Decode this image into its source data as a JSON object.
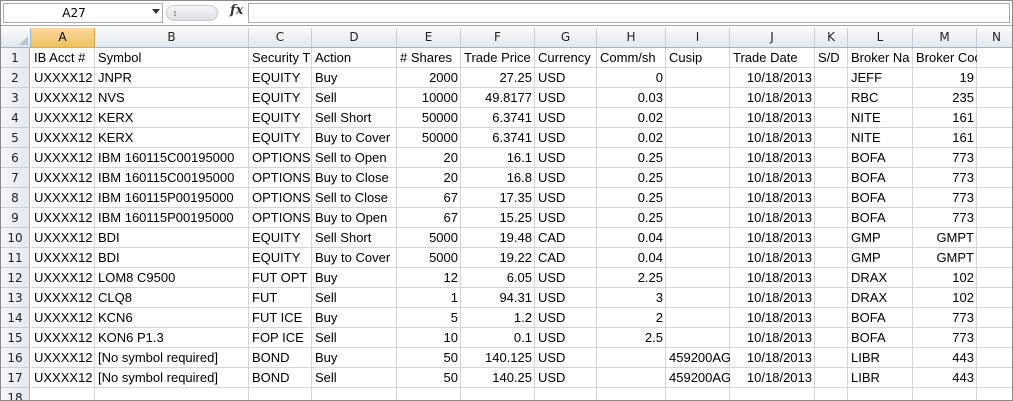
{
  "formula_bar": {
    "name_box": "A27",
    "fx_label": "fx",
    "formula": ""
  },
  "columns": [
    "A",
    "B",
    "C",
    "D",
    "E",
    "F",
    "G",
    "H",
    "I",
    "J",
    "K",
    "L",
    "M",
    "N"
  ],
  "selected_column": "A",
  "row_numbers": [
    "1",
    "2",
    "3",
    "4",
    "5",
    "6",
    "7",
    "8",
    "9",
    "10",
    "11",
    "12",
    "13",
    "14",
    "15",
    "16",
    "17",
    "18"
  ],
  "header_row": [
    "IB Acct #",
    "Symbol",
    "Security T",
    "Action",
    "# Shares",
    "Trade Price",
    "Currency",
    "Comm/sh",
    "Cusip",
    "Trade Date",
    "S/D",
    "Broker Na",
    "Broker Code"
  ],
  "rows": [
    [
      "UXXXX12",
      "JNPR",
      "EQUITY",
      "Buy",
      "2000",
      "27.25",
      "USD",
      "0",
      "",
      "10/18/2013",
      "",
      "JEFF",
      "19"
    ],
    [
      "UXXXX12",
      "NVS",
      "EQUITY",
      "Sell",
      "10000",
      "49.8177",
      "USD",
      "0.03",
      "",
      "10/18/2013",
      "",
      "RBC",
      "235"
    ],
    [
      "UXXXX12",
      "KERX",
      "EQUITY",
      "Sell Short",
      "50000",
      "6.3741",
      "USD",
      "0.02",
      "",
      "10/18/2013",
      "",
      "NITE",
      "161"
    ],
    [
      "UXXXX12",
      "KERX",
      "EQUITY",
      "Buy to Cover",
      "50000",
      "6.3741",
      "USD",
      "0.02",
      "",
      "10/18/2013",
      "",
      "NITE",
      "161"
    ],
    [
      "UXXXX12",
      "IBM   160115C00195000",
      "OPTIONS",
      "Sell to Open",
      "20",
      "16.1",
      "USD",
      "0.25",
      "",
      "10/18/2013",
      "",
      "BOFA",
      "773"
    ],
    [
      "UXXXX12",
      "IBM   160115C00195000",
      "OPTIONS",
      "Buy to Close",
      "20",
      "16.8",
      "USD",
      "0.25",
      "",
      "10/18/2013",
      "",
      "BOFA",
      "773"
    ],
    [
      "UXXXX12",
      "IBM   160115P00195000",
      "OPTIONS",
      "Sell to Close",
      "67",
      "17.35",
      "USD",
      "0.25",
      "",
      "10/18/2013",
      "",
      "BOFA",
      "773"
    ],
    [
      "UXXXX12",
      "IBM   160115P00195000",
      "OPTIONS",
      "Buy to Open",
      "67",
      "15.25",
      "USD",
      "0.25",
      "",
      "10/18/2013",
      "",
      "BOFA",
      "773"
    ],
    [
      "UXXXX12",
      "BDI",
      "EQUITY",
      "Sell Short",
      "5000",
      "19.48",
      "CAD",
      "0.04",
      "",
      "10/18/2013",
      "",
      "GMP",
      "GMPT"
    ],
    [
      "UXXXX12",
      "BDI",
      "EQUITY",
      "Buy to Cover",
      "5000",
      "19.22",
      "CAD",
      "0.04",
      "",
      "10/18/2013",
      "",
      "GMP",
      "GMPT"
    ],
    [
      "UXXXX12",
      "LOM8 C9500",
      "FUT OPT",
      "Buy",
      "12",
      "6.05",
      "USD",
      "2.25",
      "",
      "10/18/2013",
      "",
      "DRAX",
      "102"
    ],
    [
      "UXXXX12",
      "CLQ8",
      "FUT",
      "Sell",
      "1",
      "94.31",
      "USD",
      "3",
      "",
      "10/18/2013",
      "",
      "DRAX",
      "102"
    ],
    [
      "UXXXX12",
      "KCN6",
      "FUT ICE",
      "Buy",
      "5",
      "1.2",
      "USD",
      "2",
      "",
      "10/18/2013",
      "",
      "BOFA",
      "773"
    ],
    [
      "UXXXX12",
      "KON6 P1.3",
      "FOP ICE",
      "Sell",
      "10",
      "0.1",
      "USD",
      "2.5",
      "",
      "10/18/2013",
      "",
      "BOFA",
      "773"
    ],
    [
      "UXXXX12",
      "[No symbol required]",
      "BOND",
      "Buy",
      "50",
      "140.125",
      "USD",
      "",
      "459200AG",
      "10/18/2013",
      "",
      "LIBR",
      "443"
    ],
    [
      "UXXXX12",
      "[No symbol required]",
      "BOND",
      "Sell",
      "50",
      "140.25",
      "USD",
      "",
      "459200AG",
      "10/18/2013",
      "",
      "LIBR",
      "443"
    ]
  ],
  "colors": {
    "selected_header": "#f1c15f",
    "header_bg": "#e4e8ee",
    "gridline": "#d4d4d4"
  }
}
